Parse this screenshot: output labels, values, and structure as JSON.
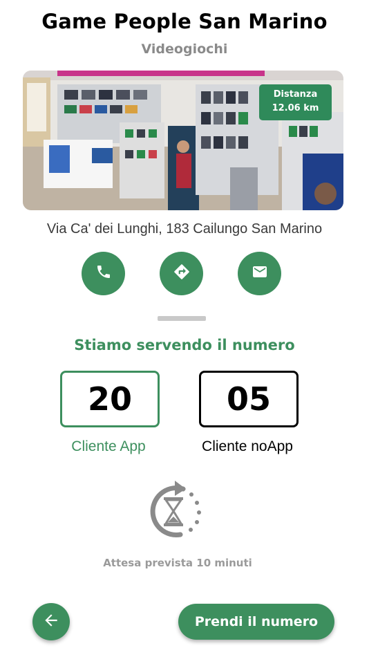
{
  "store": {
    "name": "Game People San Marino",
    "category": "Videogiochi",
    "distance_label": "Distanza",
    "distance_value": "12.06 km",
    "address": "Via Ca' dei Lunghi, 183 Cailungo San Marino"
  },
  "actions": {
    "call_icon": "phone-icon",
    "directions_icon": "directions-icon",
    "email_icon": "mail-icon"
  },
  "queue": {
    "heading": "Stiamo servendo il numero",
    "app_number": "20",
    "app_label": "Cliente App",
    "noapp_number": "05",
    "noapp_label": "Cliente noApp",
    "wait_text": "Attesa prevista 10 minuti"
  },
  "footer": {
    "back_icon": "arrow-left-icon",
    "take_number_label": "Prendi il numero"
  },
  "colors": {
    "accent": "#3d8f5e",
    "badge": "#2f8a5a",
    "muted": "#8a8a8a"
  }
}
